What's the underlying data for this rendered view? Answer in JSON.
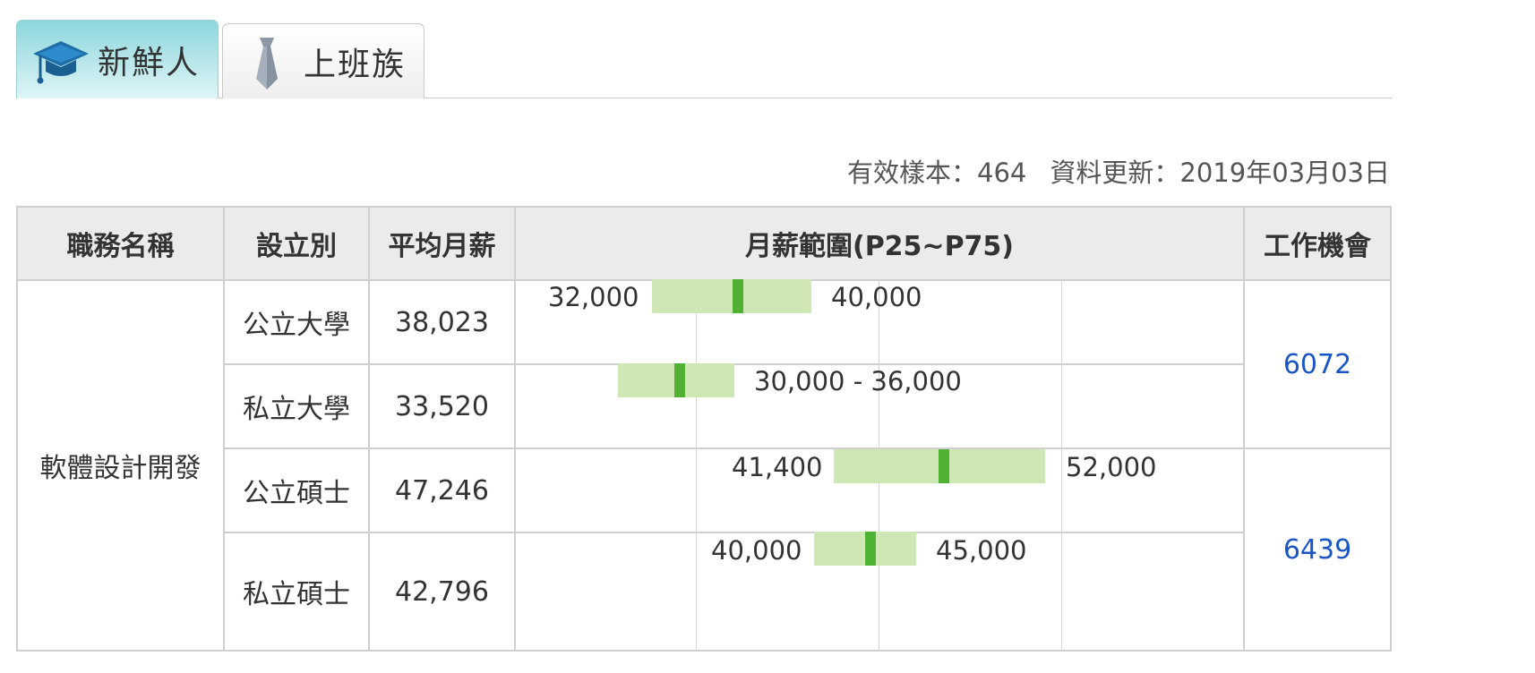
{
  "tabs": [
    {
      "label": "新鮮人",
      "icon": "graduation-cap-icon",
      "active": true
    },
    {
      "label": "上班族",
      "icon": "necktie-icon",
      "active": false
    }
  ],
  "info": {
    "sample_label": "有效樣本：464",
    "update_label": "資料更新：2019年03月03日"
  },
  "table": {
    "headers": [
      "職務名稱",
      "設立別",
      "平均月薪",
      "月薪範圍(P25~P75)",
      "工作機會"
    ],
    "job_title": "軟體設計開發",
    "rows": [
      {
        "type": "公立大學",
        "avg": "38,023",
        "p25": 32000,
        "p75": 40000,
        "p25_label": "32,000",
        "p75_label": "40,000",
        "range_label": ""
      },
      {
        "type": "私立大學",
        "avg": "33,520",
        "p25": 30000,
        "p75": 36000,
        "p25_label": "",
        "p75_label": "",
        "range_label": "30,000 - 36,000"
      },
      {
        "type": "公立碩士",
        "avg": "47,246",
        "p25": 41400,
        "p75": 52000,
        "p25_label": "41,400",
        "p75_label": "52,000",
        "range_label": ""
      },
      {
        "type": "私立碩士",
        "avg": "42,796",
        "p25": 40000,
        "p75": 45000,
        "p25_label": "40,000",
        "p75_label": "45,000",
        "range_label": ""
      }
    ],
    "jobs": [
      "6072",
      "6439"
    ]
  },
  "colors": {
    "bar": "#cfe6b5",
    "marker": "#4fb234",
    "link": "#1a56c8",
    "header_bg": "#ebebeb"
  }
}
